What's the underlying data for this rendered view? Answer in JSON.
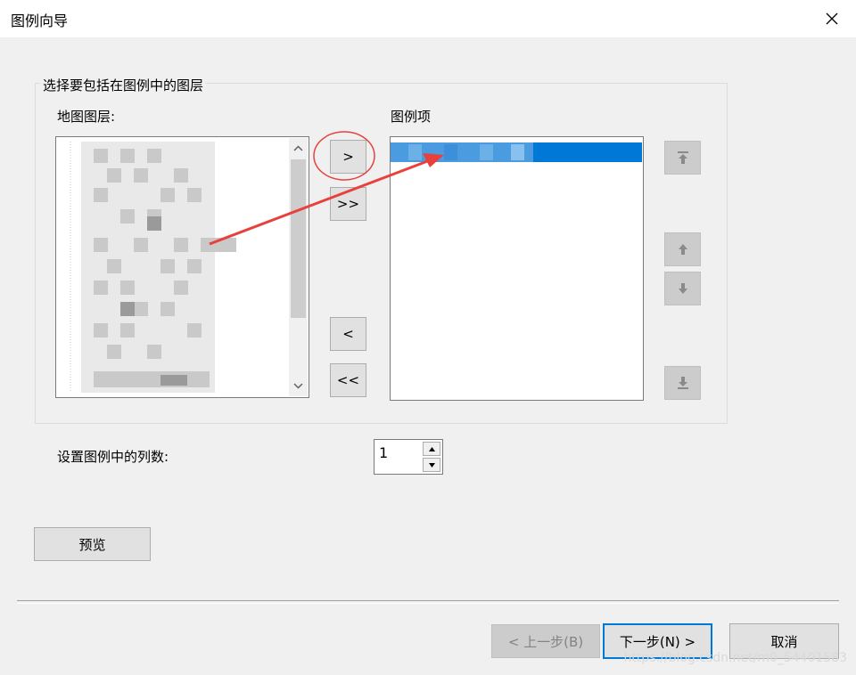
{
  "window": {
    "title": "图例向导"
  },
  "group": {
    "title": "选择要包括在图例中的图层"
  },
  "map_layers": {
    "label": "地图图层:"
  },
  "legend_items": {
    "label": "图例项"
  },
  "transfer_buttons": {
    "add": ">",
    "add_all": ">>",
    "remove": "<",
    "remove_all": "<<"
  },
  "order_buttons": {
    "move_top": "top-arrow-icon",
    "move_up": "up-arrow-icon",
    "move_down": "down-arrow-icon",
    "move_bottom": "bottom-arrow-icon"
  },
  "columns": {
    "label": "设置图例中的列数:",
    "value": "1"
  },
  "preview_button": "预览",
  "footer": {
    "back": "< 上一步(B)",
    "next": "下一步(N) >",
    "cancel": "取消"
  },
  "watermark": "https://blog.csdn.net/m0_54401583",
  "colors": {
    "accent": "#0078d7",
    "annotation": "#e8413c"
  }
}
